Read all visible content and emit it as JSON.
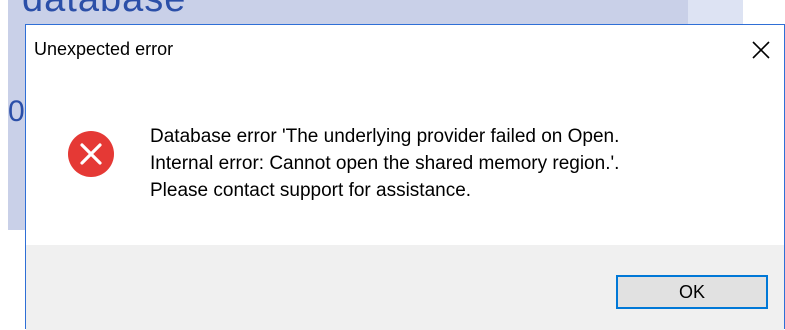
{
  "background": {
    "text": "database",
    "glyph": "0"
  },
  "dialog": {
    "title": "Unexpected error",
    "close_icon": "close-icon",
    "error_icon": "error-circle-x-icon",
    "message_lines": [
      "Database error 'The underlying provider failed on Open.",
      "Internal error: Cannot open the shared memory region.'.",
      "Please contact support for assistance."
    ],
    "ok_label": "OK"
  },
  "colors": {
    "accent": "#0078d7",
    "error": "#e53935",
    "footer_bg": "#f0f0f0"
  }
}
